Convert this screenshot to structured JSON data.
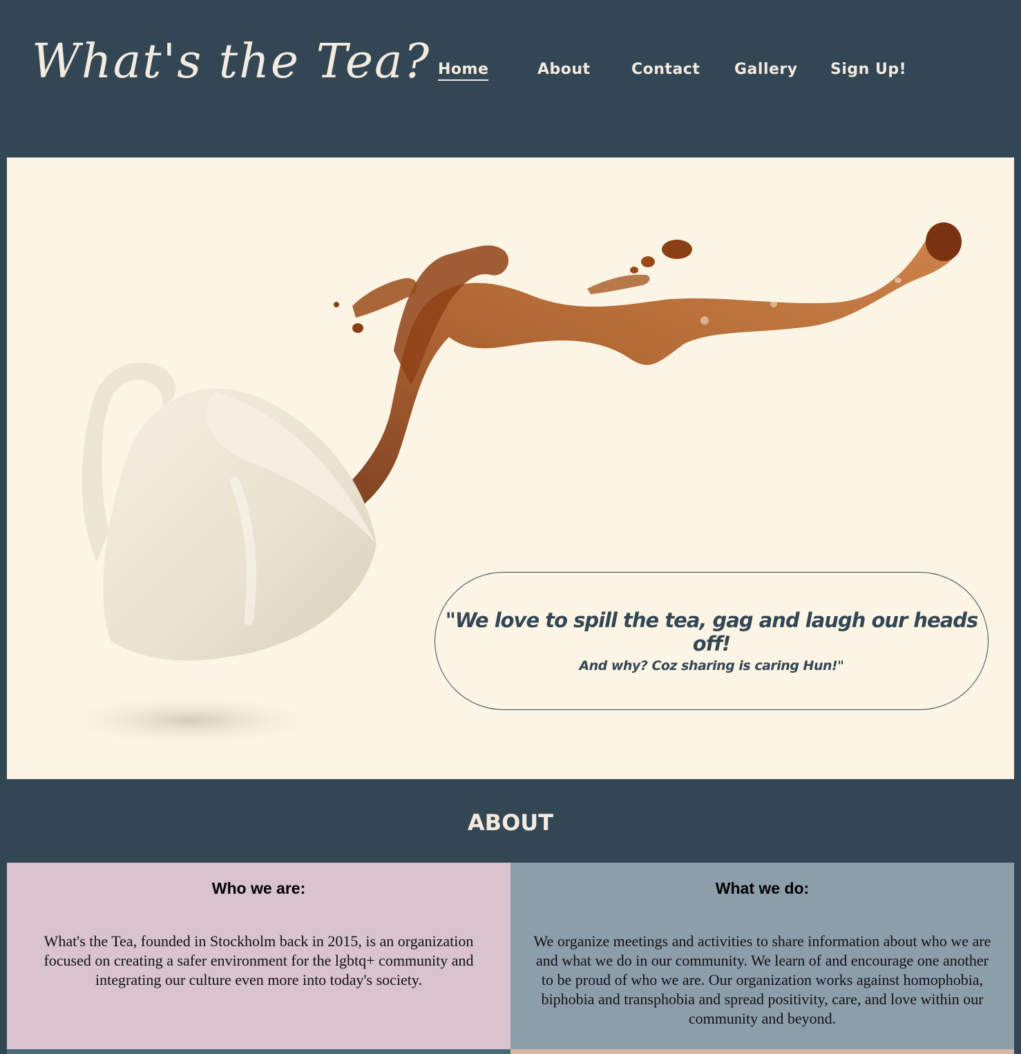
{
  "header": {
    "logo": "What's the Tea?",
    "nav": {
      "home": "Home",
      "about": "About",
      "contact": "Contact",
      "gallery": "Gallery",
      "signup": "Sign Up!"
    },
    "active": "Home"
  },
  "hero": {
    "quote": "\"We love to spill the tea, gag and laugh our heads off!",
    "subquote": "And why? Coz sharing is caring Hun!\""
  },
  "about": {
    "title": "ABOUT",
    "who": {
      "heading": "Who we are:",
      "text": "What's the Tea, founded in Stockholm back in 2015, is an organization focused on creating a safer environment for the lgbtq+ community and integrating our culture even more into today's society."
    },
    "what": {
      "heading": "What we do:",
      "text": "We organize meetings and activities to share information about who we are and what we do in our community. We learn of and encourage one another to be proud of who we are. Our organization works against homophobia, biphobia and transphobia and spread positivity, care, and love within our community and beyond."
    }
  },
  "colors": {
    "navy": "#334654",
    "cream": "#fcf5e6",
    "pink": "#d8c3cf",
    "slate": "#8d9eab",
    "tea": "#8a3f14"
  },
  "icons": [
    "teacup-illustration",
    "tea-splash-illustration"
  ]
}
